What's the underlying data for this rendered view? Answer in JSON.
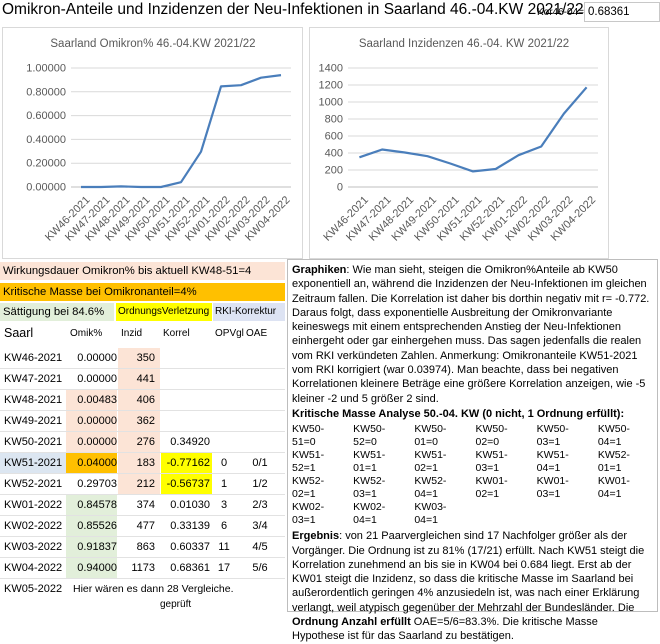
{
  "header": {
    "title": "Omikron-Anteile und Inzidenzen der Neu-Infektionen in Saarland 46.-04.KW 2021/22",
    "kor_label": "Kor46-04=",
    "kor_value": "0.68361"
  },
  "chart_data": [
    {
      "type": "line",
      "title": "Saarland Omikron% 46.-04.KW 2021/22",
      "xlabel": "",
      "ylabel": "",
      "categories": [
        "KW46-2021",
        "KW47-2021",
        "KW48-2021",
        "KW49-2021",
        "KW50-2021",
        "KW51-2021",
        "KW52-2021",
        "KW01-2022",
        "KW02-2022",
        "KW03-2022",
        "KW04-2022"
      ],
      "values": [
        0.0,
        0.0,
        0.00483,
        0.0,
        0.0,
        0.04,
        0.29703,
        0.84578,
        0.85526,
        0.91837,
        0.94
      ],
      "ylim": [
        0,
        1
      ],
      "yticks": [
        "0.00000",
        "0.20000",
        "0.40000",
        "0.60000",
        "0.80000",
        "1.00000"
      ],
      "grid": true,
      "color": "#4a7ebb"
    },
    {
      "type": "line",
      "title": "Saarland Inzidenzen 46.-04. KW 2021/22",
      "xlabel": "",
      "ylabel": "",
      "categories": [
        "KW46-2021",
        "KW47-2021",
        "KW48-2021",
        "KW49-2021",
        "KW50-2021",
        "KW51-2021",
        "KW52-2021",
        "KW01-2022",
        "KW02-2022",
        "KW03-2022",
        "KW04-2022"
      ],
      "values": [
        350,
        441,
        406,
        362,
        276,
        183,
        212,
        374,
        477,
        863,
        1173
      ],
      "ylim": [
        0,
        1400
      ],
      "yticks": [
        "0",
        "200",
        "400",
        "600",
        "800",
        "1000",
        "1200",
        "1400"
      ],
      "grid": true,
      "color": "#4a7ebb"
    }
  ],
  "info": {
    "wirkungsdauer": "Wirkungsdauer Omikron% bis aktuell KW48-51=4",
    "kritische_masse": "Kritische Masse bei Omikronanteil=4%",
    "saettigung": "Sättigung bei 84.6%",
    "ordnung": "OrdnungsVerletzung",
    "rki": "RKI-Korrektur"
  },
  "table": {
    "headers": [
      "Saarl",
      "Omik%",
      "Inzid",
      "Korrel",
      "OPVgl",
      "OAE"
    ],
    "rows": [
      {
        "kw": "KW46-2021",
        "omik": "0.00000",
        "inz": "350",
        "kor": "",
        "op": "",
        "oae": ""
      },
      {
        "kw": "KW47-2021",
        "omik": "0.00000",
        "inz": "441",
        "kor": "",
        "op": "",
        "oae": ""
      },
      {
        "kw": "KW48-2021",
        "omik": "0.00483",
        "inz": "406",
        "kor": "",
        "op": "",
        "oae": ""
      },
      {
        "kw": "KW49-2021",
        "omik": "0.00000",
        "inz": "362",
        "kor": "",
        "op": "",
        "oae": ""
      },
      {
        "kw": "KW50-2021",
        "omik": "0.00000",
        "inz": "276",
        "kor": "0.34920",
        "op": "",
        "oae": ""
      },
      {
        "kw": "KW51-2021",
        "omik": "0.04000",
        "inz": "183",
        "kor": "-0.77162",
        "op": "0",
        "oae": "0/1"
      },
      {
        "kw": "KW52-2021",
        "omik": "0.29703",
        "inz": "212",
        "kor": "-0.56737",
        "op": "1",
        "oae": "1/2"
      },
      {
        "kw": "KW01-2022",
        "omik": "0.84578",
        "inz": "374",
        "kor": "0.01030",
        "op": "3",
        "oae": "2/3"
      },
      {
        "kw": "KW02-2022",
        "omik": "0.85526",
        "inz": "477",
        "kor": "0.33139",
        "op": "6",
        "oae": "3/4"
      },
      {
        "kw": "KW03-2022",
        "omik": "0.91837",
        "inz": "863",
        "kor": "0.60337",
        "op": "11",
        "oae": "4/5"
      },
      {
        "kw": "KW04-2022",
        "omik": "0.94000",
        "inz": "1173",
        "kor": "0.68361",
        "op": "17",
        "oae": "5/6"
      }
    ],
    "last_row_kw": "KW05-2022",
    "last_row_note": "Hier wären es dann 28 Vergleiche.",
    "geprueft": "geprüft"
  },
  "textbox": {
    "p1_bold": "Graphiken",
    "p1": ": Wie man sieht, steigen die Omikron%Anteile ab KW50 exponentiell an, während die Inzidenzen der Neu-Infektionen im gleichen Zeitraum fallen.  Die Korrelation ist daher bis dorthin negativ mit r= -0.772. Daraus folgt, dass exponentielle Ausbreitung der Omikronvariante keineswegs mit einem entsprechenden Anstieg der Neu-Infektionen einhergeht oder gar einhergehen muss. Das sagen jedenfalls die realen vom RKI verkündeten Zahlen.  Anmerkung: Omikronanteile KW51-2021 vom RKI korrigiert (war 0.03974). Man beachte, dass bei negativen Korrelationen kleinere Beträge eine größere Korrelation anzeigen, wie -5 kleiner -2 und 5 größer 2 sind.",
    "p2_bold": "Kritische Masse Analyse 50.-04. KW  (0 nicht, 1 Ordnung erfüllt):",
    "eq": [
      "KW50-51=0",
      "KW50-52=0",
      "KW50-01=0",
      "KW50-02=0",
      "KW50-03=1",
      "KW50-04=1",
      "KW51-52=1",
      "KW51-01=1",
      "KW51-02=1",
      "KW51-03=1",
      "KW51-04=1",
      "KW52-01=1",
      "KW52-02=1",
      "KW52-03=1",
      "KW52-04=1",
      "KW01-02=1",
      "KW01-03=1",
      "KW01-04=1",
      "KW02-03=1",
      "KW02-04=1",
      "KW03-04=1"
    ],
    "p3_bold": "Ergebnis",
    "p3": ": von 21 Paarvergleichen sind 17 Nachfolger größer als der Vorgänger. Die Ordnung ist zu 81% (17/21) erfüllt. Nach KW51 steigt die Korrelation zunehmend an bis sie in KW04 bei 0.684 liegt. Erst ab der KW01 steigt die Inzidenz, so dass die kritische Masse im Saarland bei außerordentlich geringen 4% anzusiedeln ist, was nach einer Erklärung verlangt, weil atypisch gegenüber der Mehrzahl der Bundesländer. Die ",
    "p3_bold2": "Ordnung Anzahl erfüllt",
    "p3_end": " OAE=5/6=83.3%. Die kritische Masse Hypothese ist für das Saarland zu bestätigen."
  }
}
